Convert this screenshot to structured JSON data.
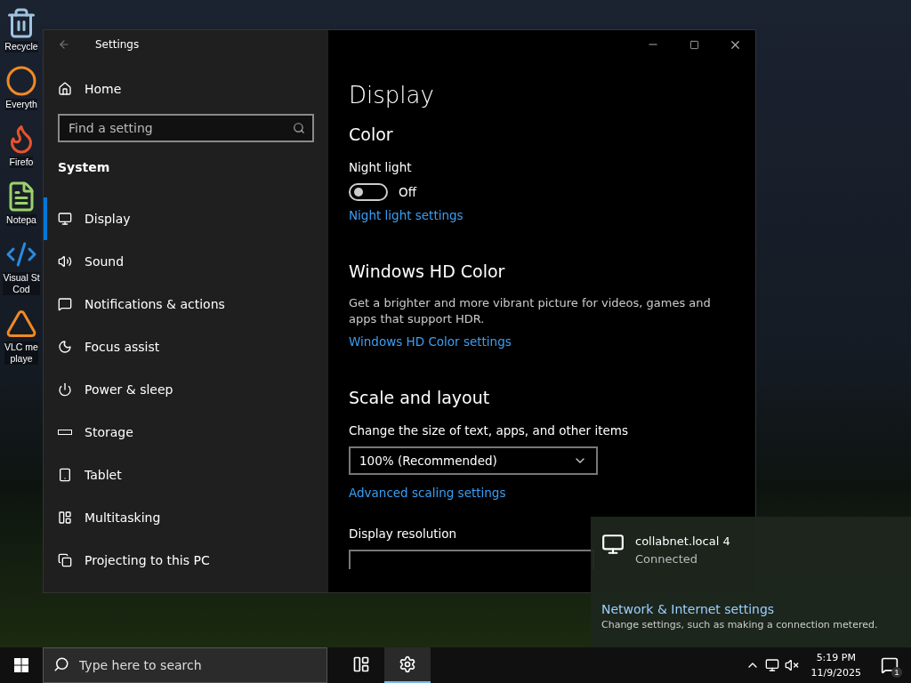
{
  "desktop_icons": [
    {
      "lines": [
        "Recycle"
      ]
    },
    {
      "lines": [
        "Everyth"
      ]
    },
    {
      "lines": [
        "Firefo"
      ]
    },
    {
      "lines": [
        "Notepa"
      ]
    },
    {
      "lines": [
        "Visual St",
        "Cod"
      ]
    },
    {
      "lines": [
        "VLC me",
        "playe"
      ]
    }
  ],
  "settings_window": {
    "title": "Settings",
    "home": "Home",
    "search": {
      "placeholder": "Find a setting"
    },
    "group": "System",
    "nav": [
      {
        "label": "Display",
        "selected": true
      },
      {
        "label": "Sound",
        "selected": false
      },
      {
        "label": "Notifications & actions",
        "selected": false
      },
      {
        "label": "Focus assist",
        "selected": false
      },
      {
        "label": "Power & sleep",
        "selected": false
      },
      {
        "label": "Storage",
        "selected": false
      },
      {
        "label": "Tablet",
        "selected": false
      },
      {
        "label": "Multitasking",
        "selected": false
      },
      {
        "label": "Projecting to this PC",
        "selected": false
      }
    ],
    "page": {
      "title": "Display",
      "sections": [
        {
          "heading": "Color",
          "items": [
            {
              "kind": "label",
              "text": "Night light"
            },
            {
              "kind": "toggle",
              "on": false,
              "text": "Off"
            },
            {
              "kind": "link",
              "text": "Night light settings"
            }
          ]
        },
        {
          "heading": "Windows HD Color",
          "items": [
            {
              "kind": "description",
              "text": "Get a brighter and more vibrant picture for videos, games and apps that support HDR."
            },
            {
              "kind": "link",
              "text": "Windows HD Color settings"
            }
          ]
        },
        {
          "heading": "Scale and layout",
          "items": [
            {
              "kind": "label",
              "text": "Change the size of text, apps, and other items"
            },
            {
              "kind": "dropdown",
              "value": "100% (Recommended)"
            },
            {
              "kind": "link",
              "text": "Advanced scaling settings"
            },
            {
              "kind": "label",
              "text": "Display resolution"
            },
            {
              "kind": "dropdown_cut"
            }
          ]
        }
      ]
    }
  },
  "network_flyout": {
    "network": {
      "name": "collabnet.local 4",
      "status": "Connected"
    },
    "link": "Network & Internet settings",
    "description": "Change settings, such as making a connection metered."
  },
  "taskbar": {
    "search": {
      "placeholder": "Type here to search"
    },
    "apps": [
      {
        "kind": "task_view",
        "selected": false
      },
      {
        "kind": "settings",
        "selected": true
      }
    ],
    "time": "5:19 PM",
    "date": "11/9/2025",
    "notifications": "1"
  }
}
